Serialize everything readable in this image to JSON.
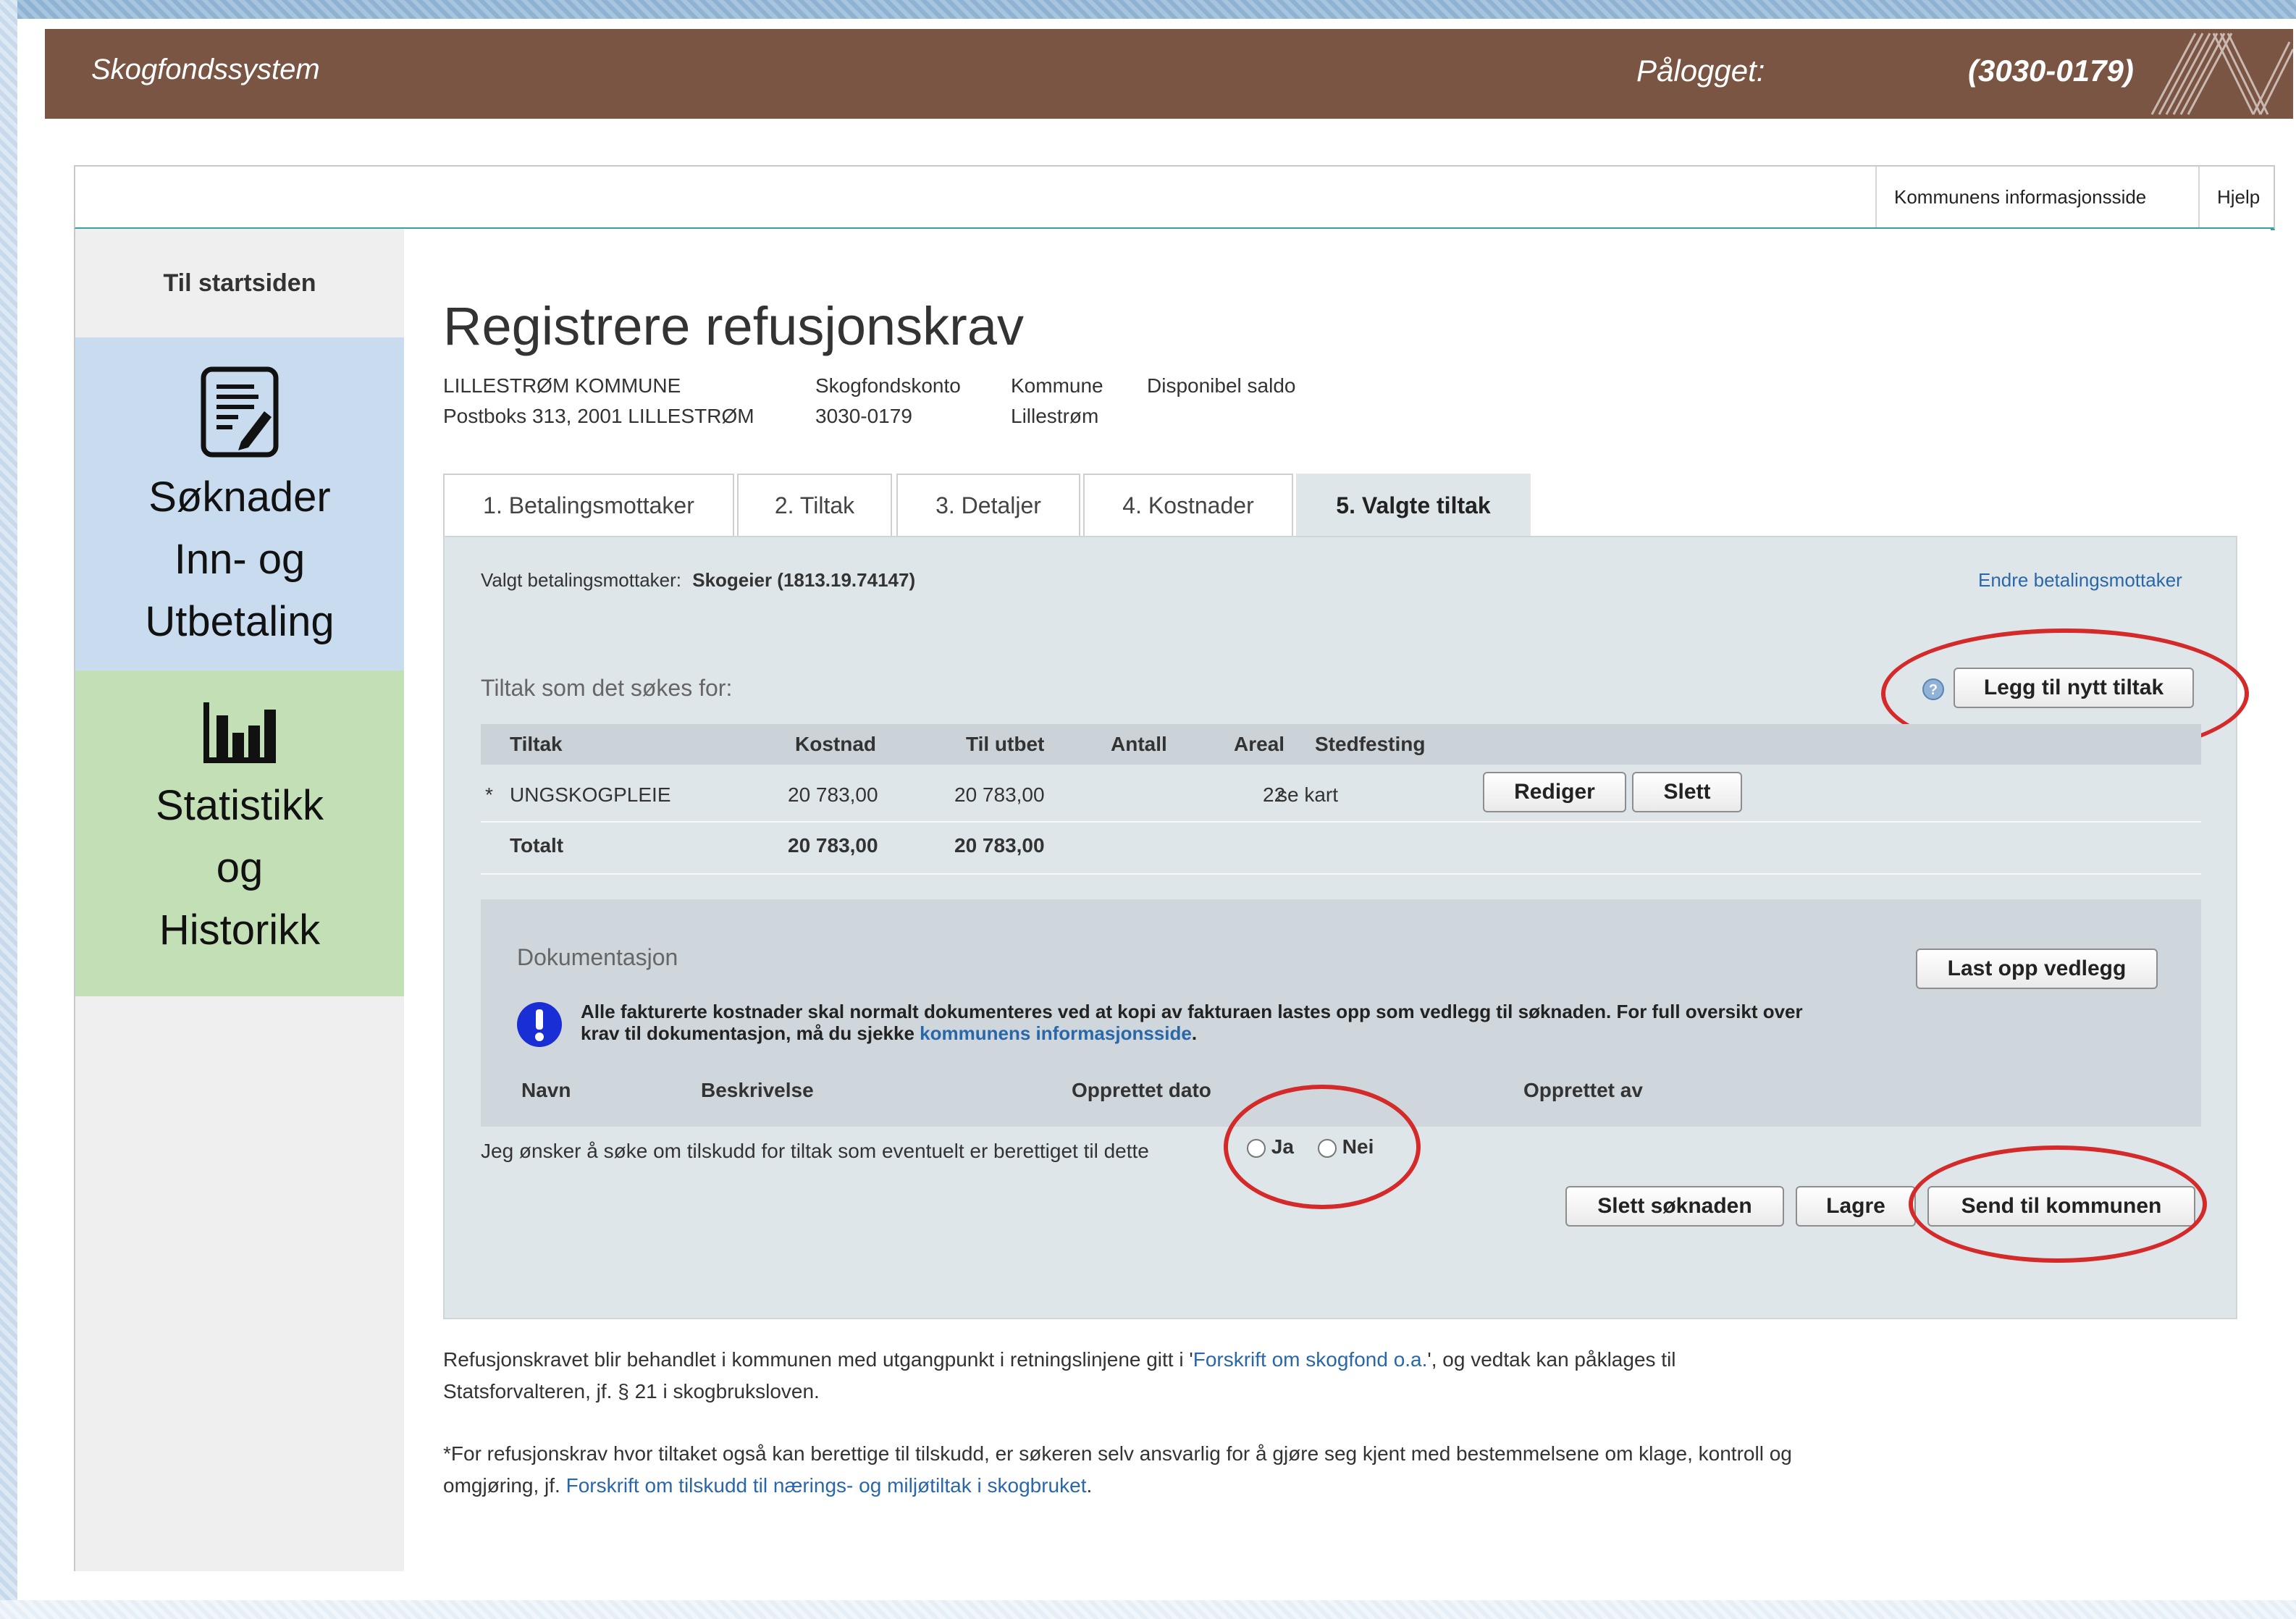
{
  "header": {
    "app_title": "Skogfondssystem",
    "logged_in_label": "Pålogget:",
    "account": "(3030-0179)"
  },
  "topbar": {
    "info_link": "Kommunens informasjonsside",
    "help_link": "Hjelp"
  },
  "sidebar": {
    "home": "Til startsiden",
    "applications": [
      "Søknader",
      "Inn- og",
      "Utbetaling"
    ],
    "statistics": [
      "Statistikk",
      "og",
      "Historikk"
    ]
  },
  "page": {
    "title": "Registrere refusjonskrav",
    "owner_name": "LILLESTRØM KOMMUNE",
    "owner_address": "Postboks 313, 2001 LILLESTRØM",
    "account_label": "Skogfondskonto",
    "account_value": "3030-0179",
    "municipality_label": "Kommune",
    "municipality_value": "Lillestrøm",
    "balance_label": "Disponibel saldo"
  },
  "tabs": [
    "1. Betalingsmottaker",
    "2. Tiltak",
    "3. Detaljer",
    "4. Kostnader",
    "5. Valgte tiltak"
  ],
  "active_tab_index": 4,
  "recipient": {
    "label": "Valgt betalingsmottaker:",
    "value": "Skogeier (1813.19.74147)",
    "change_link": "Endre betalingsmottaker"
  },
  "measures": {
    "section_label": "Tiltak som det søkes for:",
    "add_button": "Legg til nytt tiltak",
    "columns": [
      "Tiltak",
      "Kostnad",
      "Til utbet",
      "Antall",
      "Areal",
      "Stedfesting"
    ],
    "rows": [
      {
        "marker": "*",
        "tiltak": "UNGSKOGPLEIE",
        "kostnad": "20 783,00",
        "til_utbet": "20 783,00",
        "antall": "",
        "areal": "22",
        "stedfesting": "se kart",
        "edit_button": "Rediger",
        "delete_button": "Slett"
      }
    ],
    "total": {
      "label": "Totalt",
      "kostnad": "20 783,00",
      "til_utbet": "20 783,00"
    }
  },
  "documentation": {
    "title": "Dokumentasjon",
    "upload_button": "Last opp vedlegg",
    "notice_line1": "Alle fakturerte kostnader skal normalt dokumenteres ved at kopi av fakturaen lastes opp som vedlegg til søknaden. For full oversikt over",
    "notice_line2_prefix": "krav til dokumentasjon, må du sjekke ",
    "notice_link": "kommunens informasjonsside",
    "notice_suffix": ".",
    "columns": [
      "Navn",
      "Beskrivelse",
      "Opprettet dato",
      "Opprettet av"
    ]
  },
  "subsidy": {
    "question": "Jeg ønsker å søke om tilskudd for tiltak som eventuelt er berettiget til dette",
    "yes": "Ja",
    "no": "Nei"
  },
  "actions": {
    "delete_application": "Slett søknaden",
    "save": "Lagre",
    "send": "Send til kommunen"
  },
  "footer": {
    "p1_prefix": "Refusjonskravet blir behandlet i kommunen med utgangpunkt i retningslinjene gitt i '",
    "p1_link": "Forskrift om skogfond o.a.",
    "p1_suffix": "', og vedtak kan påklages til",
    "p1_line2": "Statsforvalteren, jf. § 21 i skogbruksloven.",
    "p2_line1": "*For refusjonskrav hvor tiltaket også kan berettige til tilskudd, er søkeren selv ansvarlig for å gjøre seg kjent med bestemmelsene om klage, kontroll og",
    "p2_prefix": "omgjøring, jf. ",
    "p2_link": "Forskrift om tilskudd til nærings- og miljøtiltak i skogbruket",
    "p2_suffix": "."
  },
  "colors": {
    "header_bg": "#7b5544",
    "nav_applications_bg": "#c8dbef",
    "nav_statistics_bg": "#c3dfb6",
    "panel_bg": "#dfe6ea",
    "link": "#2a67a8",
    "highlight_circle": "#d42a2a",
    "accent_line": "#3aa0a8"
  }
}
